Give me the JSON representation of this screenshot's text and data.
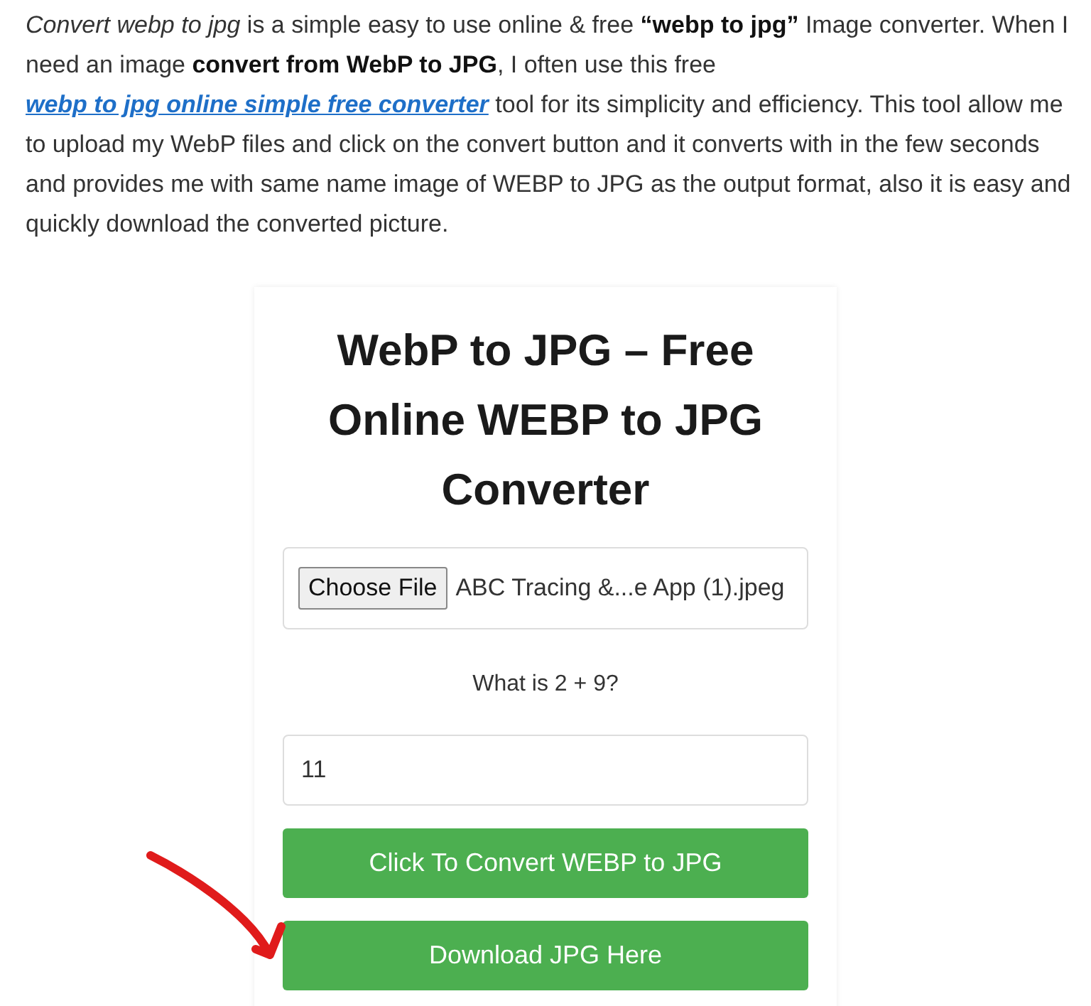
{
  "intro": {
    "before": "*Convert webp to jpg* is a simple easy to use online & free **“webp to jpg”** Image converter. When I need an image **convert from WebP to JPG**, I often use this free",
    "link": "webp to jpg online simple free converter",
    "after": "tool for its simplicity and efficiency. This tool allow me to upload my WebP files and click on the convert button and it converts with in the few seconds and provides me with same name image of WEBP to JPG as the output format, also it is easy and quickly download the converted picture."
  },
  "converter": {
    "title": "WebP to JPG – Free Online WEBP to JPG Converter",
    "file_button": "Choose File",
    "file_name": "ABC Tracing &...e App (1).jpeg",
    "question": "What is 2 + 9?",
    "answer": "11",
    "buttons": [
      "Click To Convert WEBP to JPG",
      "Download JPG Here"
    ]
  }
}
